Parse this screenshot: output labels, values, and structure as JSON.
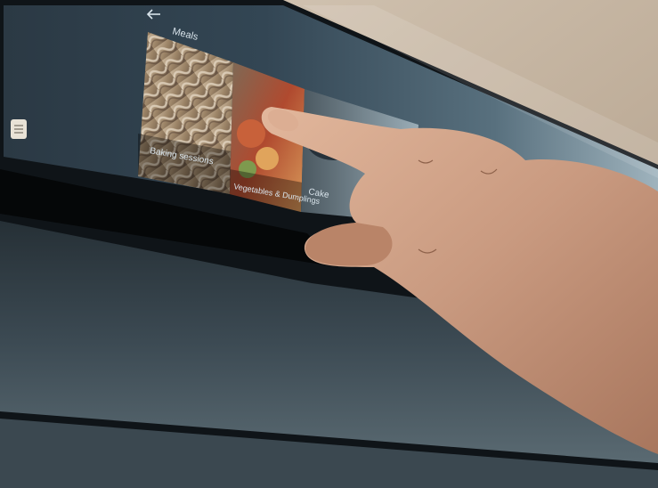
{
  "screen": {
    "title": "Meals",
    "back_icon": "arrow-left-icon",
    "side_icon": "menu-book-icon",
    "tiles": [
      {
        "label": "Baking sessions",
        "image": "bread-dough"
      },
      {
        "label": "Vegetables & Dumplings",
        "image": "stuffed-vegetables"
      },
      {
        "label": "Cake",
        "image": "cooking-pan"
      }
    ]
  },
  "colors": {
    "screen_glass": "#1f2a33",
    "oven_body": "#0f1418",
    "wall": "#bfae9a",
    "skin": "#c99a80",
    "ui_text": "#d8e3ea"
  }
}
